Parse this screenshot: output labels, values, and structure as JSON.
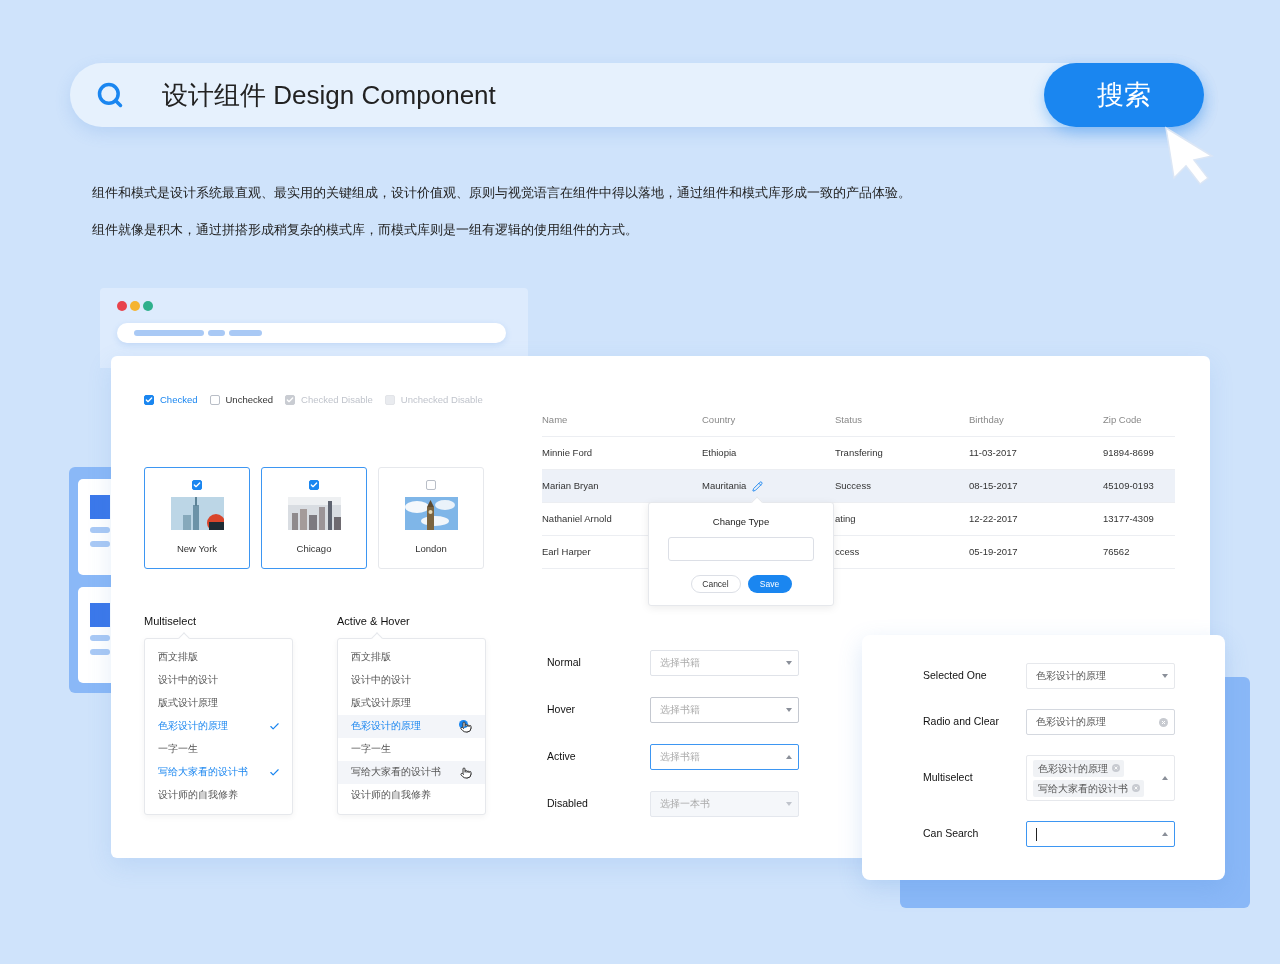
{
  "search": {
    "value": "设计组件 Design Component",
    "button": "搜索"
  },
  "intro": [
    "组件和模式是设计系统最直观、最实用的关键组成，设计价值观、原则与视觉语言在组件中得以落地，通过组件和模式库形成一致的产品体验。",
    "组件就像是积木，通过拼搭形成稍复杂的模式库，而模式库则是一组有逻辑的使用组件的方式。"
  ],
  "checkboxes": [
    {
      "label": "Checked",
      "checked": true,
      "disabled": false
    },
    {
      "label": "Unchecked",
      "checked": false,
      "disabled": false
    },
    {
      "label": "Checked Disable",
      "checked": true,
      "disabled": true
    },
    {
      "label": "Unchecked Disable",
      "checked": false,
      "disabled": true
    }
  ],
  "city_cards": [
    {
      "label": "New York",
      "checked": true,
      "kind": "picture"
    },
    {
      "label": "Chicago",
      "checked": true,
      "kind": "picture"
    },
    {
      "label": "London",
      "checked": false,
      "kind": "picture"
    }
  ],
  "multiselect": {
    "title": "Multiselect",
    "options": [
      {
        "label": "西文排版",
        "selected": false,
        "hovered": false
      },
      {
        "label": "设计中的设计",
        "selected": false,
        "hovered": false
      },
      {
        "label": "版式设计原理",
        "selected": false,
        "hovered": false
      },
      {
        "label": "色彩设计的原理",
        "selected": true,
        "hovered": false
      },
      {
        "label": "一字一生",
        "selected": false,
        "hovered": false
      },
      {
        "label": "写给大家看的设计书",
        "selected": true,
        "hovered": false
      },
      {
        "label": "设计师的自我修养",
        "selected": false,
        "hovered": false
      }
    ]
  },
  "active_hover": {
    "title": "Active & Hover",
    "options": [
      {
        "label": "西文排版",
        "selected": false,
        "hovered": false
      },
      {
        "label": "设计中的设计",
        "selected": false,
        "hovered": false
      },
      {
        "label": "版式设计原理",
        "selected": false,
        "hovered": false
      },
      {
        "label": "色彩设计的原理",
        "selected": true,
        "hovered": true
      },
      {
        "label": "一字一生",
        "selected": false,
        "hovered": false
      },
      {
        "label": "写给大家看的设计书",
        "selected": false,
        "hovered": true
      },
      {
        "label": "设计师的自我修养",
        "selected": false,
        "hovered": false
      }
    ]
  },
  "table": {
    "columns": [
      "Name",
      "Country",
      "Status",
      "Birthday",
      "Zip Code"
    ],
    "rows": [
      {
        "cells": [
          "Minnie Ford",
          "Ethiopia",
          "Transfering",
          "11-03-2017",
          "91894-8699"
        ],
        "selected": false,
        "editing": false
      },
      {
        "cells": [
          "Marian Bryan",
          "Mauritania",
          "Success",
          "08-15-2017",
          "45109-0193"
        ],
        "selected": true,
        "editing": true
      },
      {
        "cells": [
          "Nathaniel Arnold",
          "",
          "ating",
          "12-22-2017",
          "13177-4309"
        ],
        "selected": false,
        "editing": false
      },
      {
        "cells": [
          "Earl Harper",
          "",
          "ccess",
          "05-19-2017",
          "76562"
        ],
        "selected": false,
        "editing": false
      }
    ]
  },
  "popover": {
    "title": "Change Type",
    "cancel": "Cancel",
    "save": "Save"
  },
  "select_states": [
    {
      "label": "Normal",
      "placeholder": "选择书籍",
      "kind": "normal"
    },
    {
      "label": "Hover",
      "placeholder": "选择书籍",
      "kind": "hover"
    },
    {
      "label": "Active",
      "placeholder": "选择书籍",
      "kind": "active"
    },
    {
      "label": "Disabled",
      "placeholder": "选择一本书",
      "kind": "disabled"
    }
  ],
  "select_types": [
    {
      "label": "Selected One",
      "kind": "single",
      "value": "色彩设计的原理"
    },
    {
      "label": "Radio and Clear",
      "kind": "clearable",
      "value": "色彩设计的原理"
    },
    {
      "label": "Multiselect",
      "kind": "tags",
      "tags": [
        "色彩设计的原理",
        "写给大家看的设计书"
      ]
    },
    {
      "label": "Can Search",
      "kind": "search"
    }
  ]
}
